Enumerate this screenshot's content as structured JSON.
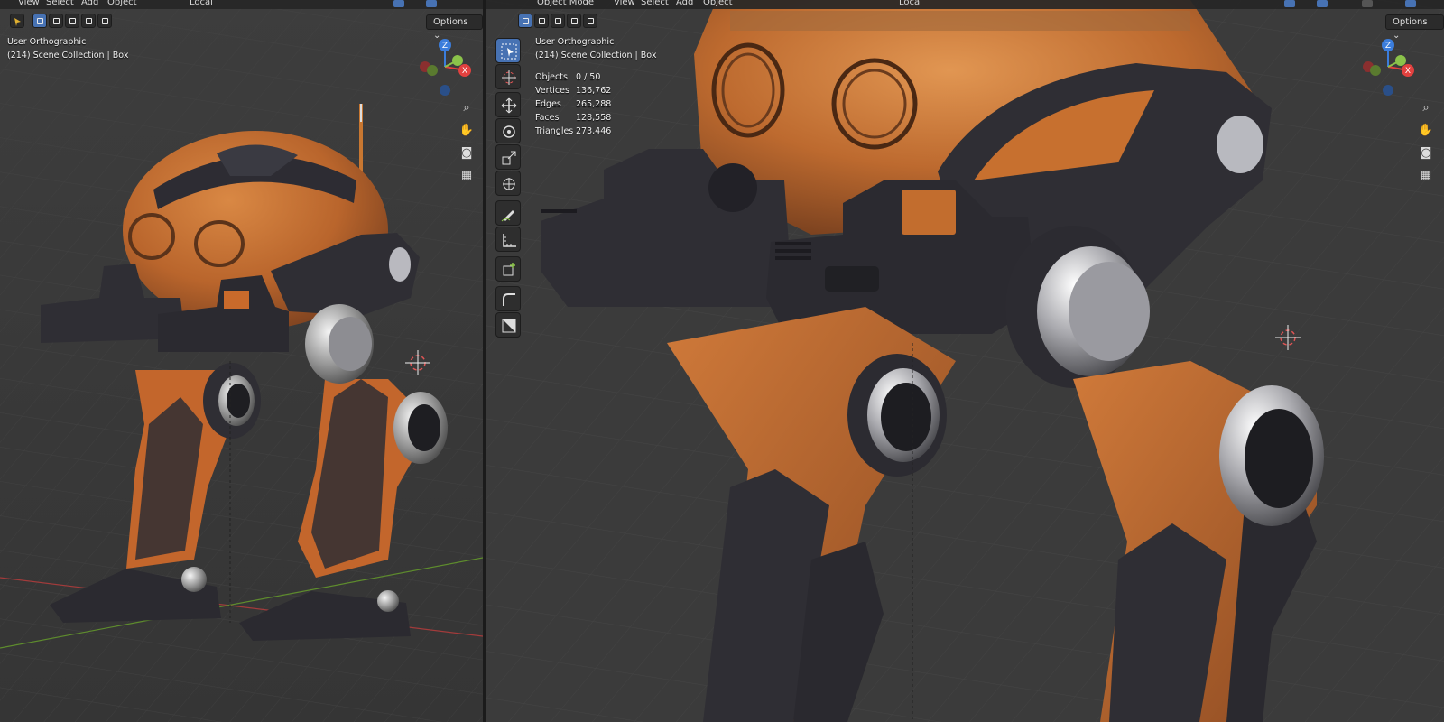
{
  "left_viewport": {
    "header": {
      "menus": [
        "View",
        "Select",
        "Add",
        "Object"
      ],
      "transform_orientation": "Local"
    },
    "options_label": "Options",
    "view_name": "User Orthographic",
    "collection": "(214) Scene Collection | Box"
  },
  "right_viewport": {
    "header": {
      "mode": "Object Mode",
      "menus": [
        "View",
        "Select",
        "Add",
        "Object"
      ],
      "transform_orientation": "Local"
    },
    "options_label": "Options",
    "view_name": "User Orthographic",
    "collection": "(214) Scene Collection | Box",
    "stats": [
      {
        "label": "Objects",
        "value": "0 / 50"
      },
      {
        "label": "Vertices",
        "value": "136,762"
      },
      {
        "label": "Edges",
        "value": "265,288"
      },
      {
        "label": "Faces",
        "value": "128,558"
      },
      {
        "label": "Triangles",
        "value": "273,446"
      }
    ],
    "tools": [
      "select-box",
      "cursor",
      "move",
      "rotate",
      "scale",
      "transform",
      "annotate",
      "measure",
      "add-cube",
      "shear",
      "bevel"
    ]
  },
  "gizmo": {
    "labels": [
      "Z",
      "X",
      "Y"
    ]
  },
  "colors": {
    "accent": "#4772b3",
    "rust_orange": "#c96a2b",
    "dark_metal": "#2f2e34",
    "axis_x": "#e2413f",
    "axis_y": "#8bc34a",
    "axis_z": "#3b7ddc"
  },
  "icons": [
    "select-box-icon",
    "zoom-icon",
    "pan-hand-icon",
    "camera-icon",
    "grid-icon",
    "3d-cursor-icon"
  ]
}
